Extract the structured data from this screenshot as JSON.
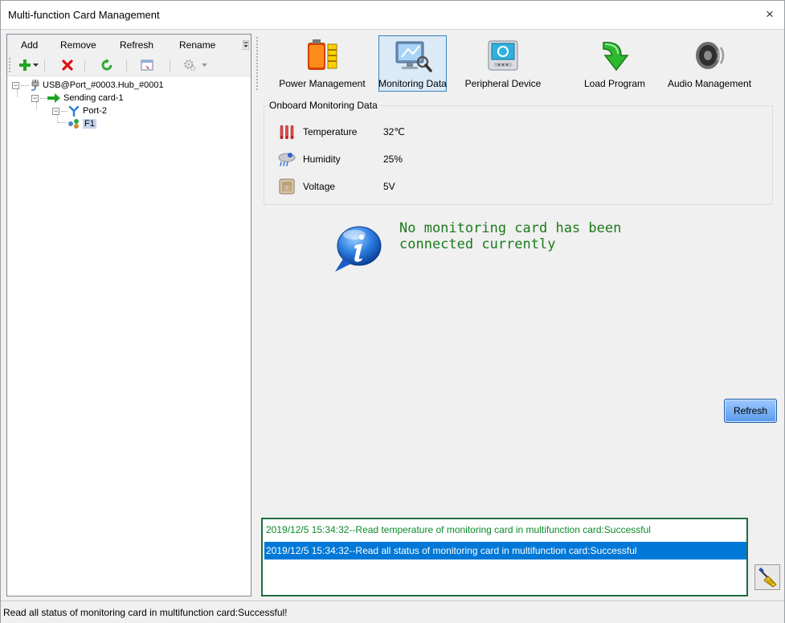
{
  "window": {
    "title": "Multi-function Card Management",
    "close_glyph": "×"
  },
  "left_menu": {
    "add": "Add",
    "remove": "Remove",
    "refresh": "Refresh",
    "rename": "Rename"
  },
  "left_toolbar": {
    "icons": [
      "add-plus-icon",
      "dropdown-arrow-icon",
      "delete-x-icon",
      "refresh-icon",
      "rename-icon",
      "settings-gear-icon",
      "dropdown-arrow-icon"
    ]
  },
  "tree": {
    "root": "USB@Port_#0003.Hub_#0001",
    "sending_card": "Sending card-1",
    "port": "Port-2",
    "card": "F1"
  },
  "right_toolbar": {
    "buttons": [
      {
        "label": "Power Management",
        "icon": "battery-icon"
      },
      {
        "label": "Monitoring Data",
        "icon": "monitor-icon",
        "active": true
      },
      {
        "label": "Peripheral Device",
        "icon": "device-icon"
      },
      {
        "label": "Load Program",
        "icon": "green-arrow-icon"
      },
      {
        "label": "Audio Management",
        "icon": "speaker-icon"
      }
    ]
  },
  "onboard": {
    "legend": "Onboard Monitoring Data",
    "rows": [
      {
        "label": "Temperature",
        "value": "32℃",
        "icon": "thermometer-icon"
      },
      {
        "label": "Humidity",
        "value": "25%",
        "icon": "humidity-cloud-icon"
      },
      {
        "label": "Voltage",
        "value": "5V",
        "icon": "voltage-icon"
      }
    ]
  },
  "notice": {
    "line1": "No monitoring card has been",
    "line2": "connected currently",
    "icon": "info-bubble-icon"
  },
  "refresh_button": "Refresh",
  "log": {
    "entries": [
      "2019/12/5 15:34:32--Read temperature of monitoring card in multifunction card:Successful",
      "2019/12/5 15:34:32--Read all status of monitoring card in multifunction card:Successful"
    ],
    "selected_index": 1
  },
  "status": {
    "text": "Read all status of monitoring card in multifunction card:Successful!"
  },
  "colors": {
    "log_text": "#0a8a2a",
    "selection": "#0078d7",
    "notice_text": "#1a7a1a",
    "refresh_button": "#5a9bea"
  }
}
